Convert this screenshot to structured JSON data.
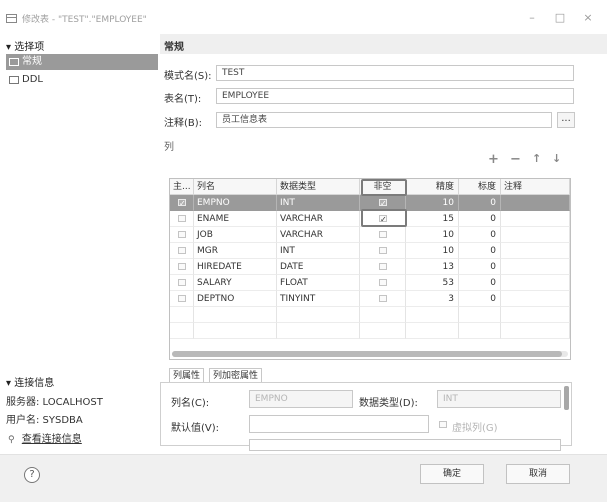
{
  "window": {
    "title": "修改表 - \"TEST\".\"EMPLOYEE\"",
    "minimize_glyph": "–",
    "maximize_glyph": "□",
    "close_glyph": "×"
  },
  "left": {
    "options_header": "▾ 选择项",
    "items": [
      {
        "label": "常规",
        "icon": "table-icon",
        "selected": true
      },
      {
        "label": "DDL",
        "icon": "ddl-icon",
        "selected": false
      }
    ],
    "conn_header": "▾ 连接信息",
    "server_label": "服务器: LOCALHOST",
    "user_label": "用户名: SYSDBA",
    "view_conn_link": "查看连接信息"
  },
  "general": {
    "title": "常规",
    "schema_label": "模式名(S):",
    "schema_value": "TEST",
    "table_label": "表名(T):",
    "table_value": "EMPLOYEE",
    "comment_label": "注释(B):",
    "comment_value": "员工信息表",
    "comment_button": "..."
  },
  "columns": {
    "group_label": "列",
    "tools": {
      "add": "+",
      "remove": "−",
      "up": "↑",
      "down": "↓"
    },
    "headers": [
      "主...",
      "列名",
      "数据类型",
      "非空",
      "精度",
      "标度",
      "注释"
    ],
    "rows": [
      {
        "pk": true,
        "name": "EMPNO",
        "type": "INT",
        "notnull": true,
        "precision": "10",
        "scale": "0",
        "comment": ""
      },
      {
        "pk": false,
        "name": "ENAME",
        "type": "VARCHAR",
        "notnull": true,
        "precision": "15",
        "scale": "0",
        "comment": ""
      },
      {
        "pk": false,
        "name": "JOB",
        "type": "VARCHAR",
        "notnull": false,
        "precision": "10",
        "scale": "0",
        "comment": ""
      },
      {
        "pk": false,
        "name": "MGR",
        "type": "INT",
        "notnull": false,
        "precision": "10",
        "scale": "0",
        "comment": ""
      },
      {
        "pk": false,
        "name": "HIREDATE",
        "type": "DATE",
        "notnull": false,
        "precision": "13",
        "scale": "0",
        "comment": ""
      },
      {
        "pk": false,
        "name": "SALARY",
        "type": "FLOAT",
        "notnull": false,
        "precision": "53",
        "scale": "0",
        "comment": ""
      },
      {
        "pk": false,
        "name": "DEPTNO",
        "type": "TINYINT",
        "notnull": false,
        "precision": "3",
        "scale": "0",
        "comment": ""
      }
    ]
  },
  "tabs": [
    "列属性",
    "列加密属性"
  ],
  "props": {
    "colname_label": "列名(C):",
    "colname_value": "EMPNO",
    "datatype_label": "数据类型(D):",
    "datatype_value": "INT",
    "default_label": "默认值(V):",
    "default_value": "",
    "virtual_label": "虚拟列(G)"
  },
  "footer": {
    "help": "?",
    "ok": "确定",
    "cancel": "取消"
  }
}
